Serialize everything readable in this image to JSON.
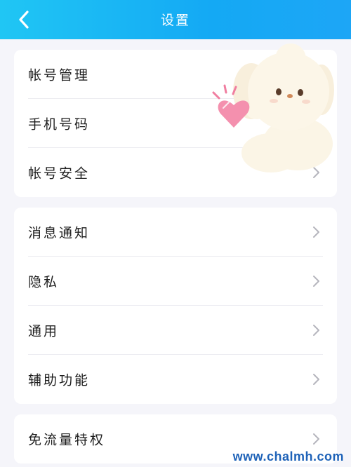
{
  "header": {
    "title": "设置",
    "back_icon": "chevron-left-icon"
  },
  "groups": [
    {
      "items": [
        {
          "label": "帐号管理",
          "has_chevron": false
        },
        {
          "label": "手机号码",
          "has_chevron": false
        },
        {
          "label": "帐号安全",
          "has_chevron": true
        }
      ]
    },
    {
      "items": [
        {
          "label": "消息通知",
          "has_chevron": true
        },
        {
          "label": "隐私",
          "has_chevron": true
        },
        {
          "label": "通用",
          "has_chevron": true
        },
        {
          "label": "辅助功能",
          "has_chevron": true
        }
      ]
    },
    {
      "items": [
        {
          "label": "免流量特权",
          "has_chevron": true
        }
      ]
    }
  ],
  "decorations": {
    "mascot": "puppy-with-heart-illustration"
  },
  "watermark": "www.chalmh.com",
  "colors": {
    "header_start": "#20c6f4",
    "header_end": "#1da6f6",
    "background": "#f5f5fa",
    "card": "#ffffff",
    "chevron": "#b5b5bd",
    "watermark": "#1e62b8"
  }
}
